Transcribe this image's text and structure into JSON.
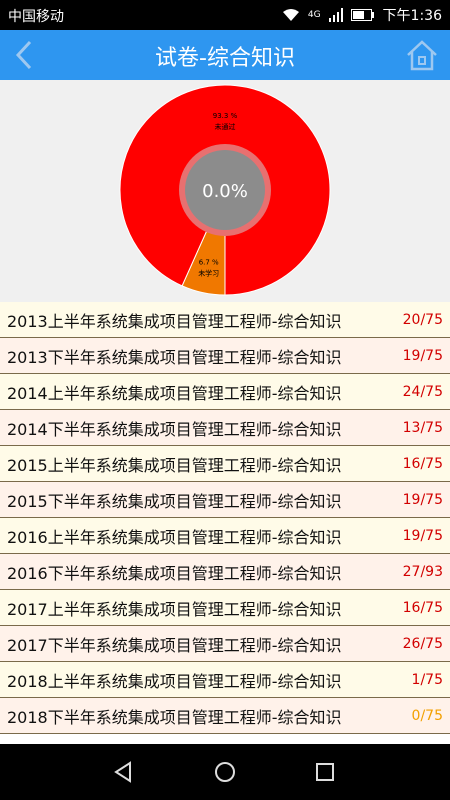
{
  "status_bar": {
    "carrier": "中国移动",
    "network": "4G",
    "time": "下午1:36"
  },
  "app_bar": {
    "title": "试卷-综合知识",
    "back_icon": "chevron-left-icon",
    "home_icon": "home-icon"
  },
  "chart_data": {
    "type": "pie",
    "center_label": "0.0%",
    "slices": [
      {
        "percent_label": "93.3 %",
        "label": "未通过",
        "value": 93.3,
        "color": "#ff0000"
      },
      {
        "percent_label": "6.7 %",
        "label": "未学习",
        "value": 6.7,
        "color": "#f07800"
      }
    ]
  },
  "papers": [
    {
      "name": "2013上半年系统集成项目管理工程师-综合知识",
      "score": "20/75",
      "status": "red"
    },
    {
      "name": "2013下半年系统集成项目管理工程师-综合知识",
      "score": "19/75",
      "status": "red"
    },
    {
      "name": "2014上半年系统集成项目管理工程师-综合知识",
      "score": "24/75",
      "status": "red"
    },
    {
      "name": "2014下半年系统集成项目管理工程师-综合知识",
      "score": "13/75",
      "status": "red"
    },
    {
      "name": "2015上半年系统集成项目管理工程师-综合知识",
      "score": "16/75",
      "status": "red"
    },
    {
      "name": "2015下半年系统集成项目管理工程师-综合知识",
      "score": "19/75",
      "status": "red"
    },
    {
      "name": "2016上半年系统集成项目管理工程师-综合知识",
      "score": "19/75",
      "status": "red"
    },
    {
      "name": "2016下半年系统集成项目管理工程师-综合知识",
      "score": "27/93",
      "status": "red"
    },
    {
      "name": "2017上半年系统集成项目管理工程师-综合知识",
      "score": "16/75",
      "status": "red"
    },
    {
      "name": "2017下半年系统集成项目管理工程师-综合知识",
      "score": "26/75",
      "status": "red"
    },
    {
      "name": "2018上半年系统集成项目管理工程师-综合知识",
      "score": "1/75",
      "status": "red"
    },
    {
      "name": "2018下半年系统集成项目管理工程师-综合知识",
      "score": "0/75",
      "status": "orange"
    }
  ],
  "nav_bar": {
    "back_icon": "triangle-back-icon",
    "home_icon": "circle-home-icon",
    "recents_icon": "square-recents-icon"
  }
}
